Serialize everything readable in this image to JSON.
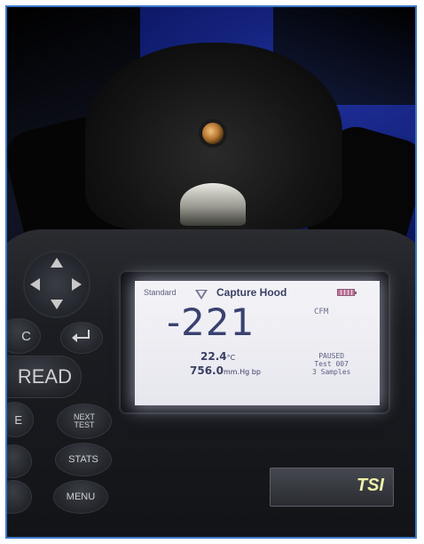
{
  "device": {
    "brand_logo": "TSI",
    "buttons": {
      "c_label": "C",
      "read_label": "READ",
      "e_label": "E",
      "next_line1": "NEXT",
      "next_line2": "TEST",
      "stats_label": "STATS",
      "menu_label": "MENU"
    },
    "icons": [
      "up-arrow-icon",
      "down-arrow-icon",
      "left-arrow-icon",
      "right-arrow-icon",
      "enter-icon",
      "triangle-icon",
      "battery-icon"
    ]
  },
  "screen": {
    "profile": "Standard",
    "mode": "Capture Hood",
    "reading": "-221",
    "unit": "CFM",
    "temperature": "22.4",
    "temperature_unit": "°C",
    "barometric": "756.0",
    "barometric_unit": "mm.Hg bp",
    "status": "PAUSED",
    "test_number": "Test 007",
    "samples": "3 Samples"
  },
  "colors": {
    "frame_border": "#3c78c8",
    "lcd_background": "#ececf2",
    "lcd_text": "#3a4170",
    "battery": "#c07898"
  }
}
